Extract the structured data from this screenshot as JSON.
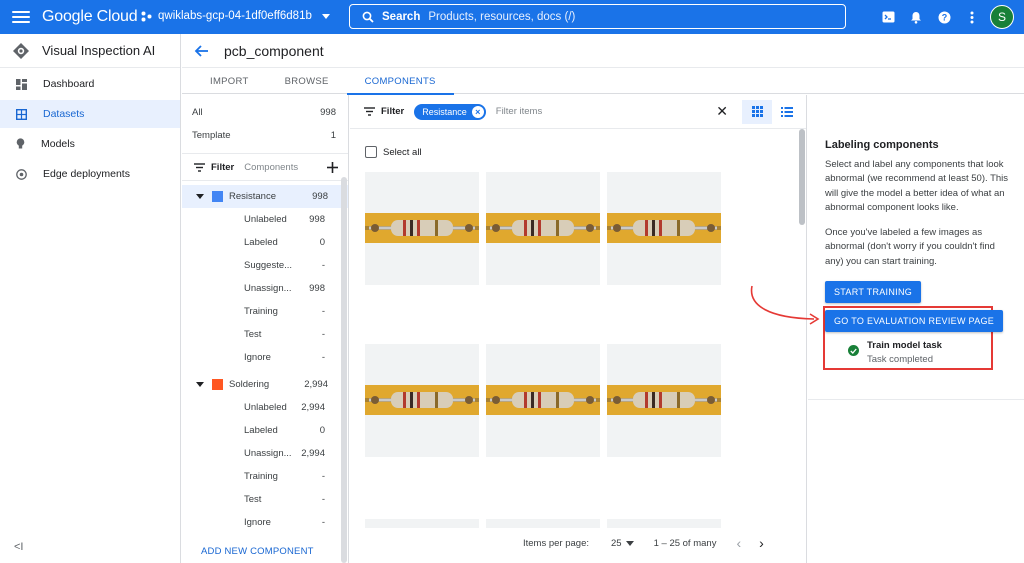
{
  "topbar": {
    "brand": "Google Cloud",
    "project": "qwiklabs-gcp-04-1df0eff6d81b",
    "search_label": "Search",
    "search_placeholder": "Products, resources, docs (/)",
    "avatar_initial": "S"
  },
  "leftnav": {
    "product": "Visual Inspection AI",
    "items": [
      {
        "label": "Dashboard",
        "icon": "dashboard-icon"
      },
      {
        "label": "Datasets",
        "icon": "datasets-icon",
        "active": true
      },
      {
        "label": "Models",
        "icon": "lightbulb-icon"
      },
      {
        "label": "Edge deployments",
        "icon": "edge-icon"
      }
    ],
    "collapse": "<I"
  },
  "header": {
    "title": "pcb_component",
    "tabs": [
      "IMPORT",
      "BROWSE",
      "COMPONENTS"
    ],
    "active_tab": "COMPONENTS"
  },
  "components_panel": {
    "all_label": "All",
    "all_count": "998",
    "template_label": "Template",
    "template_count": "1",
    "filter_label": "Filter",
    "filter_placeholder": "Components",
    "components": [
      {
        "name": "Resistance",
        "count": "998",
        "color": "#4285f4",
        "sub": [
          {
            "label": "Unlabeled",
            "value": "998"
          },
          {
            "label": "Labeled",
            "value": "0"
          },
          {
            "label": "Suggeste...",
            "value": "-"
          },
          {
            "label": "Unassign...",
            "value": "998"
          },
          {
            "label": "Training",
            "value": "-"
          },
          {
            "label": "Test",
            "value": "-"
          },
          {
            "label": "Ignore",
            "value": "-"
          }
        ]
      },
      {
        "name": "Soldering",
        "count": "2,994",
        "color": "#ff5722",
        "sub": [
          {
            "label": "Unlabeled",
            "value": "2,994"
          },
          {
            "label": "Labeled",
            "value": "0"
          },
          {
            "label": "Unassign...",
            "value": "2,994"
          },
          {
            "label": "Training",
            "value": "-"
          },
          {
            "label": "Test",
            "value": "-"
          },
          {
            "label": "Ignore",
            "value": "-"
          }
        ]
      }
    ],
    "add_component": "ADD NEW COMPONENT"
  },
  "images": {
    "filter_label": "Filter",
    "chip": "Resistance",
    "filter_placeholder": "Filter items",
    "select_all": "Select all",
    "items_per_page_label": "Items per page:",
    "items_per_page": "25",
    "range": "1 – 25 of many"
  },
  "right_panel": {
    "title": "Labeling components",
    "para1": "Select and label any components that look abnormal (we recommend at least 50). This will give the model a better idea of what an abnormal component looks like.",
    "para2": "Once you've labeled a few images as abnormal (don't worry if you couldn't find any) you can start training.",
    "start_training": "START TRAINING",
    "go_eval": "GO TO EVALUATION REVIEW PAGE",
    "task_name": "Train model task",
    "task_status": "Task completed"
  },
  "colors": {
    "primary": "#1a73e8",
    "highlight_box": "#e53935",
    "success": "#188038"
  }
}
